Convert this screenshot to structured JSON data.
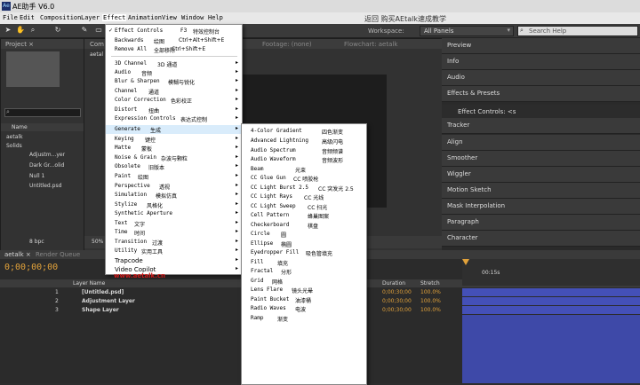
{
  "title_bar": {
    "title": "AE助手 V6.0"
  },
  "overlay_text": "返回    购买AEtalk速成教学",
  "menubar": [
    "File",
    "Edit",
    "Composition",
    "Layer",
    "Effect",
    "Animation",
    "View",
    "Window",
    "Help"
  ],
  "toolbar": {
    "workspace_label": "Workspace:",
    "workspace_value": "All Panels",
    "search_placeholder": "Search Help"
  },
  "panels": {
    "project": "Project ×",
    "comp_tab": "Com",
    "comp_sub": "aetal",
    "footage": "Footage: (none)",
    "flowchart": "Flowchart: aetalk",
    "project_col": "Name",
    "project_items": [
      "aetalk",
      "Solids",
      "Adjustm...yer",
      "Dark Gr...olid",
      "Null 1",
      "Untitled.psd"
    ],
    "bpc": "8 bpc",
    "zoom": "50%"
  },
  "right_panels": [
    "Preview",
    "Info",
    "Audio",
    "Effects & Presets",
    "Effect Controls: <s",
    "Tracker",
    "Align",
    "Smoother",
    "Wiggler",
    "Motion Sketch",
    "Mask Interpolation",
    "Paragraph",
    "Character"
  ],
  "effect_menu": {
    "top": [
      {
        "label": "Effect Controls",
        "cn": "特效控制台",
        "shortcut": "F3",
        "checked": true
      },
      {
        "label": "Backwards",
        "cn": "绘图",
        "shortcut": "Ctrl+Alt+Shift+E"
      },
      {
        "label": "Remove All",
        "cn": "全部移除",
        "shortcut": "Ctrl+Shift+E"
      }
    ],
    "items": [
      {
        "label": "3D Channel",
        "cn": "3D 通道"
      },
      {
        "label": "Audio",
        "cn": "音频"
      },
      {
        "label": "Blur & Sharpen",
        "cn": "模糊与锐化"
      },
      {
        "label": "Channel",
        "cn": "通道"
      },
      {
        "label": "Color Correction",
        "cn": "色彩校正"
      },
      {
        "label": "Distort",
        "cn": "扭曲"
      },
      {
        "label": "Expression Controls",
        "cn": "表达式控制"
      },
      {
        "label": "Generate",
        "cn": "生成"
      },
      {
        "label": "Keying",
        "cn": "键控"
      },
      {
        "label": "Matte",
        "cn": "蒙板"
      },
      {
        "label": "Noise & Grain",
        "cn": "杂波与颗粒"
      },
      {
        "label": "Obsolete",
        "cn": "旧版本"
      },
      {
        "label": "Paint",
        "cn": "绘图"
      },
      {
        "label": "Perspective",
        "cn": "透视"
      },
      {
        "label": "Simulation",
        "cn": "模拟仿真"
      },
      {
        "label": "Stylize",
        "cn": "风格化"
      },
      {
        "label": "Synthetic Aperture",
        "cn": ""
      },
      {
        "label": "Text",
        "cn": "文字"
      },
      {
        "label": "Time",
        "cn": "时间"
      },
      {
        "label": "Transition",
        "cn": "过渡"
      },
      {
        "label": "Utility",
        "cn": "实用工具"
      },
      {
        "label": "Trapcode",
        "cn": ""
      },
      {
        "label": "Video Copilot",
        "cn": ""
      }
    ],
    "watermark": "www.aetalk.cn"
  },
  "generate_submenu": [
    {
      "label": "4-Color Gradient",
      "cn": "四色渐变"
    },
    {
      "label": "Advanced Lightning",
      "cn": "高级闪电"
    },
    {
      "label": "Audio Spectrum",
      "cn": "音频频谱"
    },
    {
      "label": "Audio Waveform",
      "cn": "音频波形"
    },
    {
      "label": "Beam",
      "cn": "光束"
    },
    {
      "label": "CC Glue Gun",
      "cn": "CC 喷胶枪"
    },
    {
      "label": "CC Light Burst 2.5",
      "cn": "CC 突发光 2.5"
    },
    {
      "label": "CC Light Rays",
      "cn": "CC 光线"
    },
    {
      "label": "CC Light Sweep",
      "cn": "CC 扫光"
    },
    {
      "label": "Cell Pattern",
      "cn": "蜂巢图案"
    },
    {
      "label": "Checkerboard",
      "cn": "棋盘"
    },
    {
      "label": "Circle",
      "cn": "圆"
    },
    {
      "label": "Ellipse",
      "cn": "椭圆"
    },
    {
      "label": "Eyedropper Fill",
      "cn": "吸色管填充"
    },
    {
      "label": "Fill",
      "cn": "填充"
    },
    {
      "label": "Fractal",
      "cn": "分形"
    },
    {
      "label": "Grid",
      "cn": "网格"
    },
    {
      "label": "Lens Flare",
      "cn": "镜头光晕"
    },
    {
      "label": "Paint Bucket",
      "cn": "油漆桶"
    },
    {
      "label": "Radio Waves",
      "cn": "电波"
    },
    {
      "label": "Ramp",
      "cn": "渐变"
    }
  ],
  "timeline": {
    "tab": "aetalk ×",
    "render": "Render Queue",
    "timecode": "0;00;00;00",
    "col_layer": "Layer Name",
    "col_duration": "Duration",
    "col_stretch": "Stretch",
    "time_marker": "00:15s",
    "layers": [
      {
        "num": "1",
        "name": "[Untitled.psd]",
        "duration": "0;00;30;00",
        "stretch": "100.0%"
      },
      {
        "num": "2",
        "name": "Adjustment Layer",
        "duration": "0;00;30;00",
        "stretch": "100.0%"
      },
      {
        "num": "3",
        "name": "Shape Layer",
        "duration": "0;00;30;00",
        "stretch": "100.0%"
      }
    ]
  }
}
